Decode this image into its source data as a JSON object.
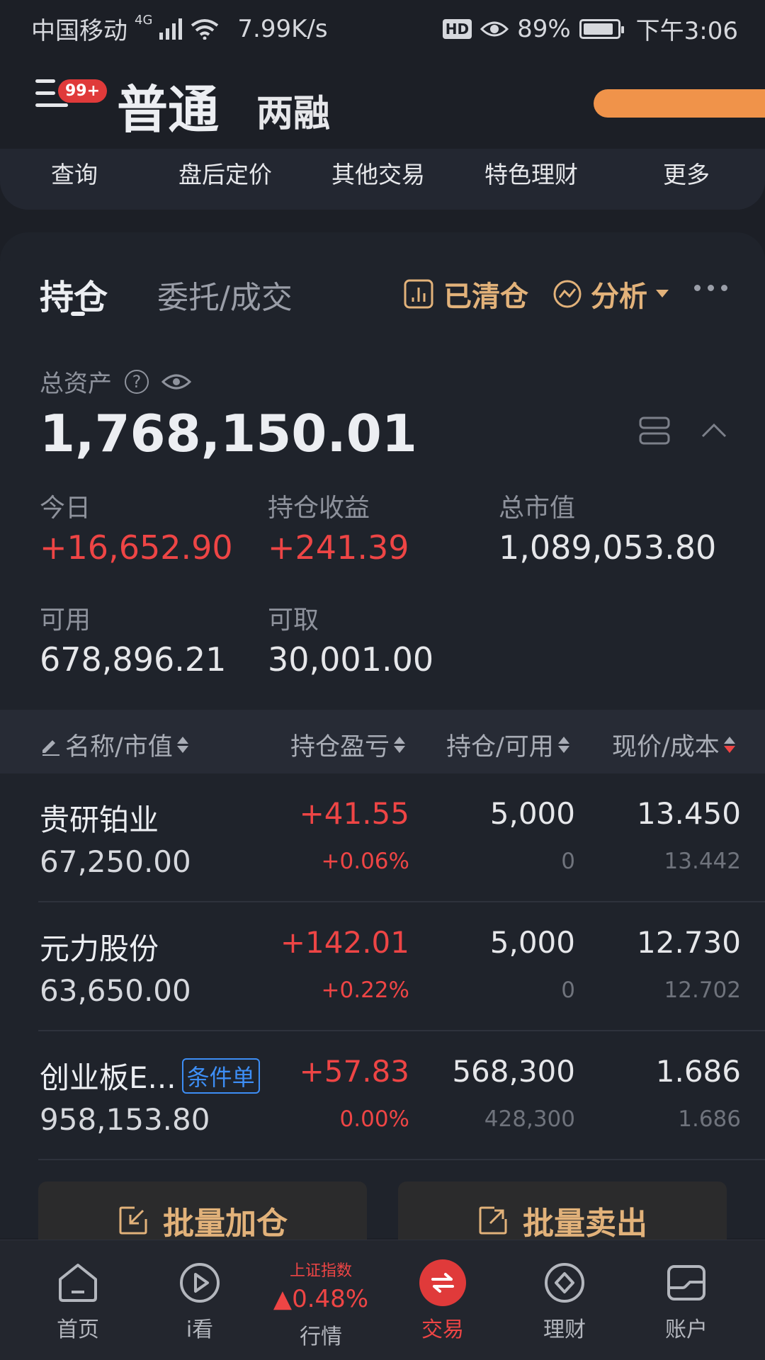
{
  "status_bar": {
    "carrier": "中国移动",
    "network": "4G",
    "speed": "7.99K/s",
    "hd": "HD",
    "battery": "89%",
    "battery_level": 0.89,
    "time": "下午3:06"
  },
  "header": {
    "badge": "99+",
    "tabs": [
      "普通",
      "两融"
    ]
  },
  "subnav": [
    "查询",
    "盘后定价",
    "其他交易",
    "特色理财",
    "更多"
  ],
  "holdings_tabs": {
    "position": "持仓",
    "orders": "委托/成交",
    "cleared": "已清仓",
    "analysis": "分析"
  },
  "summary": {
    "total_label": "总资产",
    "help": "?",
    "total_value": "1,768,150.01",
    "stats": [
      {
        "label": "今日",
        "value": "+16,652.90",
        "color": "#ee4545"
      },
      {
        "label": "持仓收益",
        "value": "+241.39",
        "color": "#ee4545"
      },
      {
        "label": "总市值",
        "value": "1,089,053.80",
        "color": "#e6e7ea"
      },
      {
        "label": "可用",
        "value": "678,896.21",
        "color": "#e6e7ea"
      },
      {
        "label": "可取",
        "value": "30,001.00",
        "color": "#e6e7ea"
      }
    ]
  },
  "table": {
    "columns": [
      "名称/市值",
      "持仓盈亏",
      "持仓/可用",
      "现价/成本"
    ],
    "rows": [
      {
        "name": "贵研铂业",
        "market_value": "67,250.00",
        "pnl": "+41.55",
        "pnl_pct": "+0.06%",
        "position": "5,000",
        "available": "0",
        "price": "13.450",
        "cost": "13.442"
      },
      {
        "name": "元力股份",
        "market_value": "63,650.00",
        "pnl": "+142.01",
        "pnl_pct": "+0.22%",
        "position": "5,000",
        "available": "0",
        "price": "12.730",
        "cost": "12.702"
      },
      {
        "name": "创业板E...",
        "tag": "条件单",
        "market_value": "958,153.80",
        "pnl": "+57.83",
        "pnl_pct": "0.00%",
        "position": "568,300",
        "available": "428,300",
        "price": "1.686",
        "cost": "1.686"
      }
    ]
  },
  "batch_buttons": {
    "add": "批量加仓",
    "sell": "批量卖出"
  },
  "bottom_nav": {
    "home": "首页",
    "watch": "i看",
    "market_index_name": "上证指数",
    "market_index_pct": "0.48%",
    "market": "行情",
    "trade": "交易",
    "finance": "理财",
    "account": "账户"
  },
  "colors": {
    "accent_red": "#e03a3a",
    "gain": "#ee4545",
    "gold": "#e2b27a",
    "tag_blue": "#3d8ef5"
  }
}
